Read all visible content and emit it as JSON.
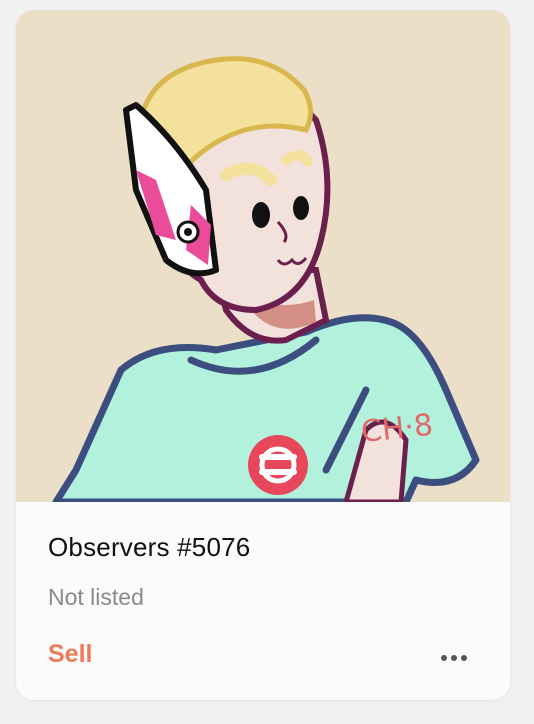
{
  "card": {
    "title": "Observers #5076",
    "status": "Not listed",
    "sell_label": "Sell",
    "more_icon": "more-horizontal-icon"
  },
  "artwork": {
    "shirt_text": "CH·8",
    "colors": {
      "background": "#ecdfc7",
      "hair": "#f4e19c",
      "skin": "#f3e1dc",
      "shirt": "#b2f2dc",
      "outline": "#6b1f4c",
      "headset_pink": "#ea4c9a",
      "logo_red": "#e8475b"
    }
  },
  "colors": {
    "sell": "#ef7a5a",
    "status": "#8a8a8a",
    "title": "#111111"
  }
}
